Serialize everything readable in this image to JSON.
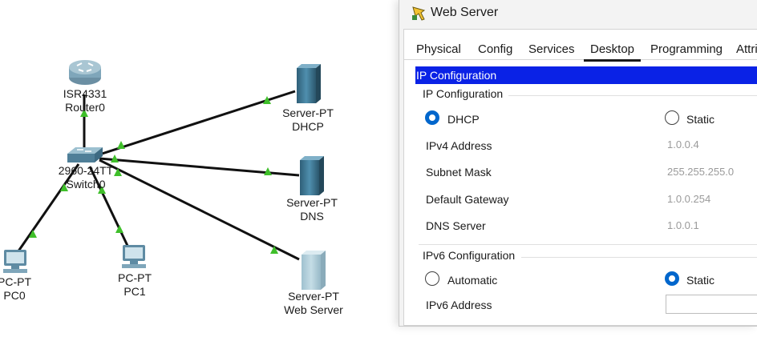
{
  "topology": {
    "router": {
      "model": "ISR4331",
      "name": "Router0"
    },
    "switch": {
      "model": "2960-24TT",
      "name": "Switch0"
    },
    "pc0": {
      "model": "PC-PT",
      "name": "PC0"
    },
    "pc1": {
      "model": "PC-PT",
      "name": "PC1"
    },
    "server_dhcp": {
      "model": "Server-PT",
      "name": "DHCP"
    },
    "server_dns": {
      "model": "Server-PT",
      "name": "DNS"
    },
    "server_web": {
      "model": "Server-PT",
      "name": "Web Server"
    },
    "link_color": "#111111",
    "link_status_color": "#3fbf2a"
  },
  "window": {
    "title": "Web Server",
    "tabs": [
      {
        "label": "Physical"
      },
      {
        "label": "Config"
      },
      {
        "label": "Services"
      },
      {
        "label": "Desktop",
        "active": true
      },
      {
        "label": "Programming"
      },
      {
        "label": "Attri"
      }
    ]
  },
  "ip_configuration": {
    "header": "IP Configuration",
    "ipv4_section": "IP Configuration",
    "mode_dhcp": "DHCP",
    "mode_static": "Static",
    "selected_mode": "DHCP",
    "fields": {
      "ipv4_label": "IPv4 Address",
      "ipv4_value": "1.0.0.4",
      "subnet_label": "Subnet Mask",
      "subnet_value": "255.255.255.0",
      "gateway_label": "Default Gateway",
      "gateway_value": "1.0.0.254",
      "dns_label": "DNS Server",
      "dns_value": "1.0.0.1"
    },
    "ipv6_section": "IPv6 Configuration",
    "ipv6_mode_auto": "Automatic",
    "ipv6_mode_static": "Static",
    "ipv6_selected_mode": "Static",
    "ipv6_address_label": "IPv6 Address",
    "ipv6_address_value": "",
    "accent_color": "#0a22e6"
  }
}
